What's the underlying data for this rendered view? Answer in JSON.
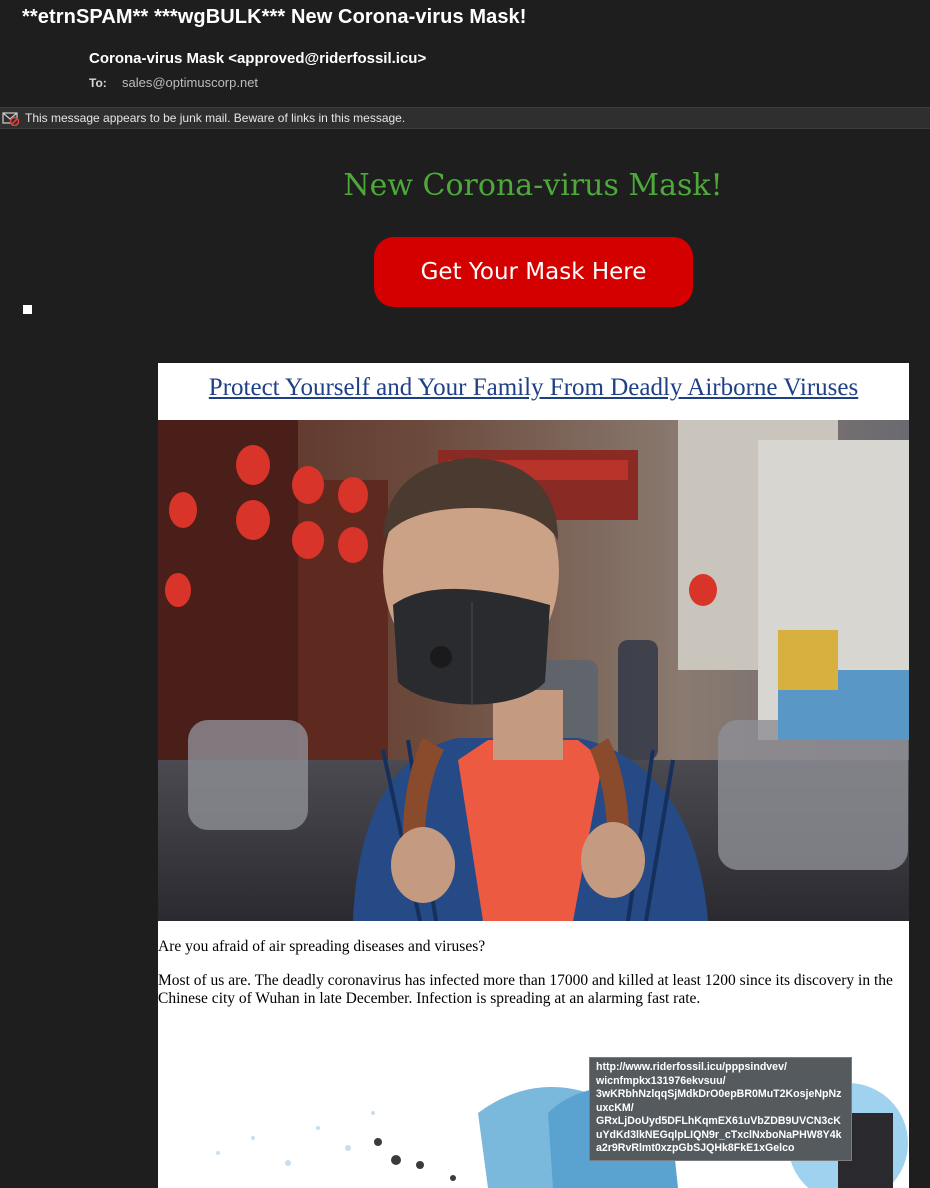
{
  "email": {
    "subject": "**etrnSPAM** ***wgBULK*** New Corona-virus Mask!",
    "from": "Corona-virus Mask <approved@riderfossil.icu>",
    "to_label": "To:",
    "to_value": "sales@optimuscorp.net"
  },
  "junk_banner": {
    "icon": "junk-mail-icon",
    "text": "This message appears to be junk mail. Beware of links in this message."
  },
  "body": {
    "headline": "New Corona-virus Mask!",
    "cta_label": "Get Your Mask Here",
    "card_title": "Protect Yourself and Your Family From Deadly Airborne Viruses",
    "paragraph_1": "Are you afraid of air spreading diseases and viruses?",
    "paragraph_2": "Most of us are. The deadly coronavirus has infected more than 17000 and killed at least 1200 since its discovery in the Chinese city of Wuhan in late December. Infection is spreading at an alarming fast rate."
  },
  "link_tooltip": {
    "url": "http://www.riderfossil.icu/pppsindvev/\nwicnfmpkx131976ekvsuu/\n3wKRbhNzlqqSjMdkDrO0epBR0MuT2KosjeNpNz\nuxcKM/\nGRxLjDoUyd5DFLhKqmEX61uVbZDB9UVCN3cK\nuYdKd3lkNEGqlpLIQN9r_cTxclNxboNaPHW8Y4k\na2r9RvRlmt0xzpGbSJQHk8FkE1xGelco"
  },
  "colors": {
    "headline": "#4ca93a",
    "cta_background": "#d40000",
    "card_title": "#1f3f86"
  }
}
